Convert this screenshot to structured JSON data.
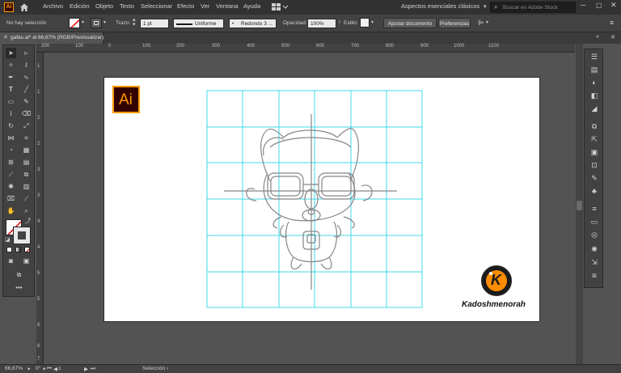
{
  "app": {
    "logo_text": "Ai"
  },
  "menu": [
    "Archivo",
    "Edición",
    "Objeto",
    "Texto",
    "Seleccionar",
    "Efecto",
    "Ver",
    "Ventana",
    "Ayuda"
  ],
  "workspace": "Aspectos esenciales clásicos",
  "search_placeholder": "Buscar en Adobe Stock",
  "control": {
    "selection_label": "No hay selección",
    "stroke_label": "Trazo:",
    "stroke_value": "1 pt",
    "profile": "Uniforme",
    "brush": "Redondo 3 ...",
    "opacity_label": "Opacidad:",
    "opacity_value": "100%",
    "style_label": "Estilo:",
    "adjust_doc": "Ajustar documento",
    "preferences": "Preferencias"
  },
  "document_tab": "gafas.ai* al 66,67% (RGB/Previsualizar)",
  "rulers": {
    "top": [
      "200",
      "100",
      "0",
      "100",
      "200",
      "300",
      "400",
      "500",
      "600",
      "700",
      "800",
      "900",
      "1000",
      "1100"
    ],
    "left": [
      "1",
      "1",
      "2",
      "2",
      "3",
      "3",
      "4",
      "4",
      "5",
      "5",
      "6",
      "6",
      "7"
    ]
  },
  "artboard": {
    "logo_text": "Ai",
    "brand_name": "Kadoshmenorah",
    "brand_initial": "K"
  },
  "status": {
    "zoom": "66,67%",
    "angle": "0°",
    "page": "1",
    "tool": "Selección"
  },
  "colors": {
    "grid": "#3fd8e8",
    "sketch": "#858585",
    "ai_orange": "#ff9a00",
    "ai_dark": "#330000",
    "brand_orange": "#ff8c00"
  }
}
